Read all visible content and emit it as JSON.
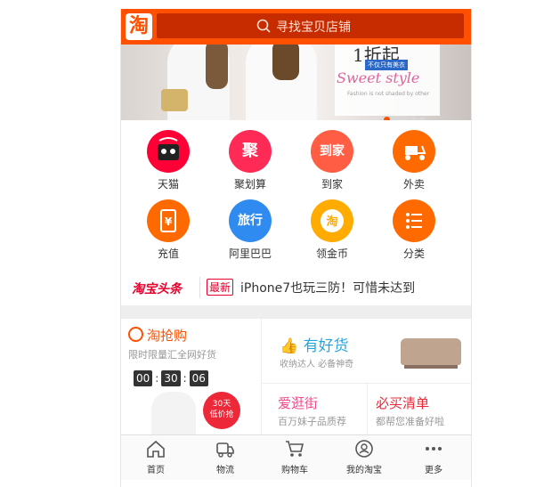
{
  "header": {
    "logo_text": "淘",
    "search_placeholder": "寻找宝贝店铺",
    "accent_color": "#ff5000"
  },
  "banner": {
    "promo_big": "1折起",
    "promo_sub": "不仅只有美衣",
    "promo_style": "Sweet style",
    "promo_tiny": "Fashion is not shaded by other",
    "active_dot": 0,
    "dot_count": 5
  },
  "icons": [
    {
      "label": "天猫",
      "glyph": "",
      "color": "#ff0036",
      "icon": "tmall-icon"
    },
    {
      "label": "聚划算",
      "glyph": "聚",
      "color": "#ff2a55",
      "icon": "juhuasuan-icon"
    },
    {
      "label": "到家",
      "glyph": "到家",
      "color": "#ff5d44",
      "icon": "daojia-icon"
    },
    {
      "label": "外卖",
      "glyph": "",
      "color": "#ff6a00",
      "icon": "waimai-icon"
    },
    {
      "label": "充值",
      "glyph": "¥",
      "color": "#ff6a00",
      "icon": "recharge-icon"
    },
    {
      "label": "阿里巴巴",
      "glyph": "旅行",
      "color": "#2f8bf0",
      "icon": "alibaba-icon"
    },
    {
      "label": "领金币",
      "glyph": "淘",
      "color": "#ffab00",
      "icon": "gold-coin-icon"
    },
    {
      "label": "分类",
      "glyph": "",
      "color": "#ff6a00",
      "icon": "category-icon"
    }
  ],
  "news": {
    "logo": "淘宝头条",
    "tag": "最新",
    "headline": "iPhone7也玩三防！可惜未达到"
  },
  "taoqianggou": {
    "title": "淘抢购",
    "subtitle": "限时限量汇全网好货",
    "hours": "00",
    "minutes": "30",
    "seconds": "06",
    "badge_line1": "30天",
    "badge_line2": "低价抢"
  },
  "youhaohuo": {
    "title": "有好货",
    "subtitle": "收纳达人 必备神奇"
  },
  "aiguangjie": {
    "title": "爱逛街",
    "subtitle": "百万妹子品质荐"
  },
  "bimaiqingdan": {
    "title": "必买清单",
    "subtitle": "都帮您准备好啦"
  },
  "tabbar": [
    {
      "label": "首页",
      "icon": "home-icon"
    },
    {
      "label": "物流",
      "icon": "truck-icon"
    },
    {
      "label": "购物车",
      "icon": "cart-icon"
    },
    {
      "label": "我的淘宝",
      "icon": "user-icon"
    },
    {
      "label": "更多",
      "icon": "more-icon"
    }
  ]
}
